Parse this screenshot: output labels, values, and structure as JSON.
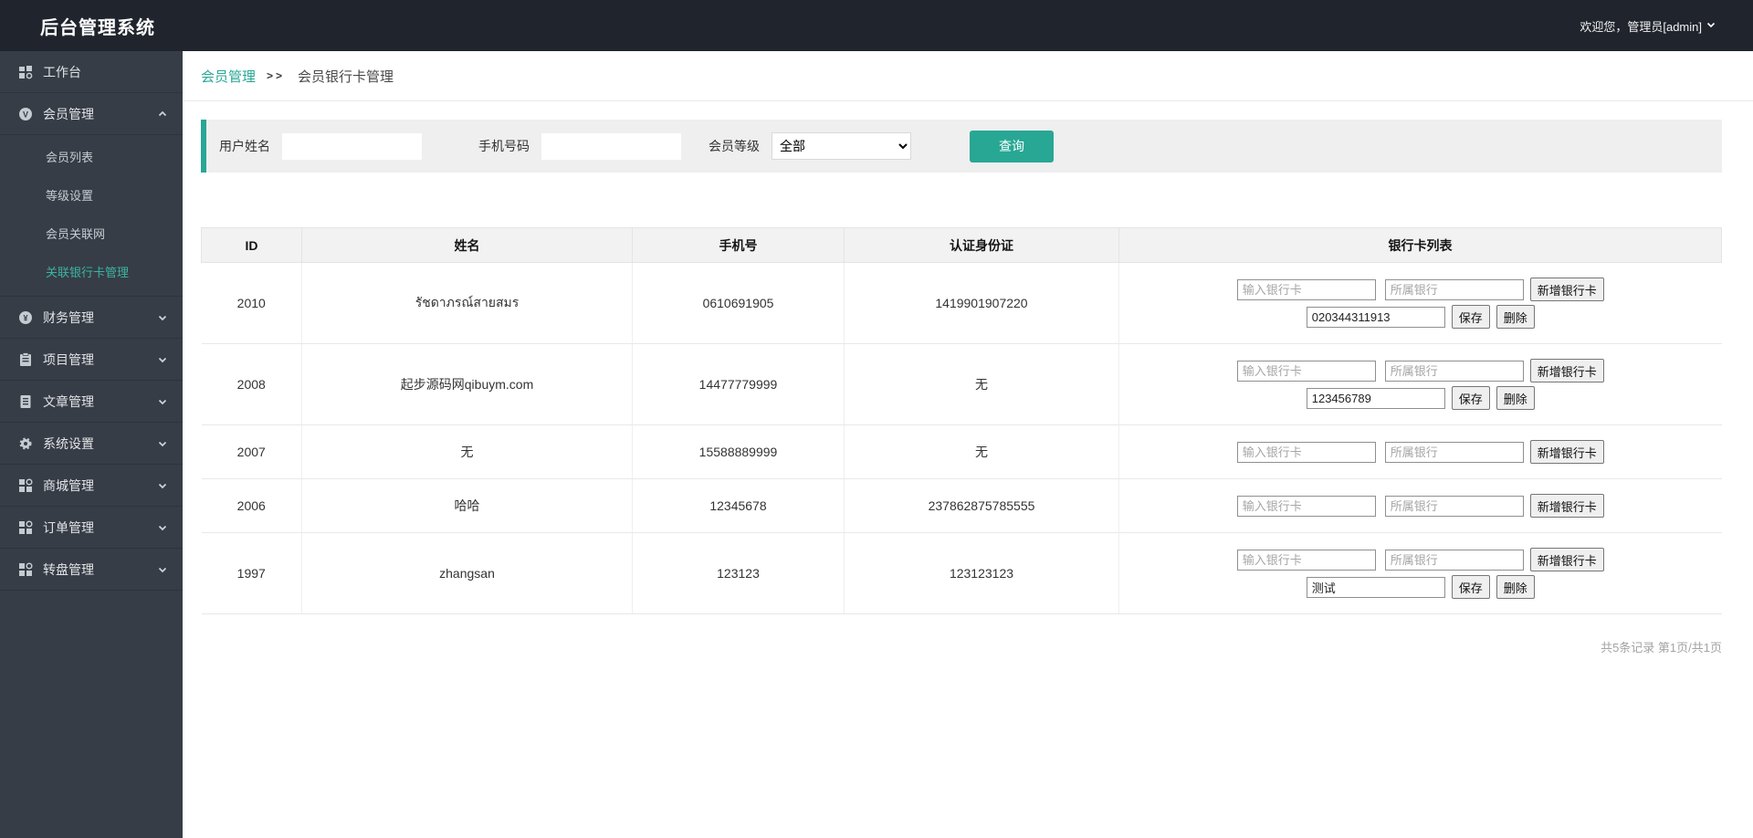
{
  "header": {
    "title": "后台管理系统",
    "welcome": "欢迎您，管理员[admin]"
  },
  "sidebar": {
    "items": [
      {
        "key": "workbench",
        "label": "工作台",
        "icon": "workbench"
      },
      {
        "key": "member",
        "label": "会员管理",
        "icon": "member",
        "expanded": true,
        "children": [
          "会员列表",
          "等级设置",
          "会员关联网",
          "关联银行卡管理"
        ],
        "active_child_index": 3
      },
      {
        "key": "finance",
        "label": "财务管理",
        "icon": "finance",
        "collapsed": true
      },
      {
        "key": "project",
        "label": "项目管理",
        "icon": "project",
        "collapsed": true
      },
      {
        "key": "article",
        "label": "文章管理",
        "icon": "article",
        "collapsed": true
      },
      {
        "key": "settings",
        "label": "系统设置",
        "icon": "settings",
        "collapsed": true
      },
      {
        "key": "mall",
        "label": "商城管理",
        "icon": "mall",
        "collapsed": true
      },
      {
        "key": "order",
        "label": "订单管理",
        "icon": "order",
        "collapsed": true
      },
      {
        "key": "wheel",
        "label": "转盘管理",
        "icon": "wheel",
        "collapsed": true
      }
    ]
  },
  "breadcrumb": {
    "parent": "会员管理",
    "separator": ">>",
    "current": "会员银行卡管理"
  },
  "filter": {
    "name_label": "用户姓名",
    "name_value": "",
    "phone_label": "手机号码",
    "phone_value": "",
    "level_label": "会员等级",
    "level_selected": "全部",
    "search_button": "查询"
  },
  "table": {
    "columns": [
      "ID",
      "姓名",
      "手机号",
      "认证身份证",
      "银行卡列表"
    ],
    "card_placeholder_number": "输入银行卡",
    "card_placeholder_bank": "所属银行",
    "add_button": "新增银行卡",
    "save_button": "保存",
    "delete_button": "删除",
    "rows": [
      {
        "id": "2010",
        "name": "รัชดาภรณ์สายสมร",
        "phone": "0610691905",
        "idcard": "1419901907220",
        "cards": [
          "020344311913"
        ]
      },
      {
        "id": "2008",
        "name": "起步源码网qibuym.com",
        "phone": "14477779999",
        "idcard": "无",
        "cards": [
          "123456789"
        ]
      },
      {
        "id": "2007",
        "name": "无",
        "phone": "15588889999",
        "idcard": "无",
        "cards": []
      },
      {
        "id": "2006",
        "name": "哈哈",
        "phone": "12345678",
        "idcard": "237862875785555",
        "cards": []
      },
      {
        "id": "1997",
        "name": "zhangsan",
        "phone": "123123",
        "idcard": "123123123",
        "cards": [
          "测试"
        ]
      }
    ]
  },
  "pagination": {
    "summary": "共5条记录 第1页/共1页"
  },
  "colors": {
    "accent": "#28a795",
    "sidebar_active": "#3db3a2",
    "header_bg": "#20242d",
    "sidebar_bg": "#363d46"
  }
}
